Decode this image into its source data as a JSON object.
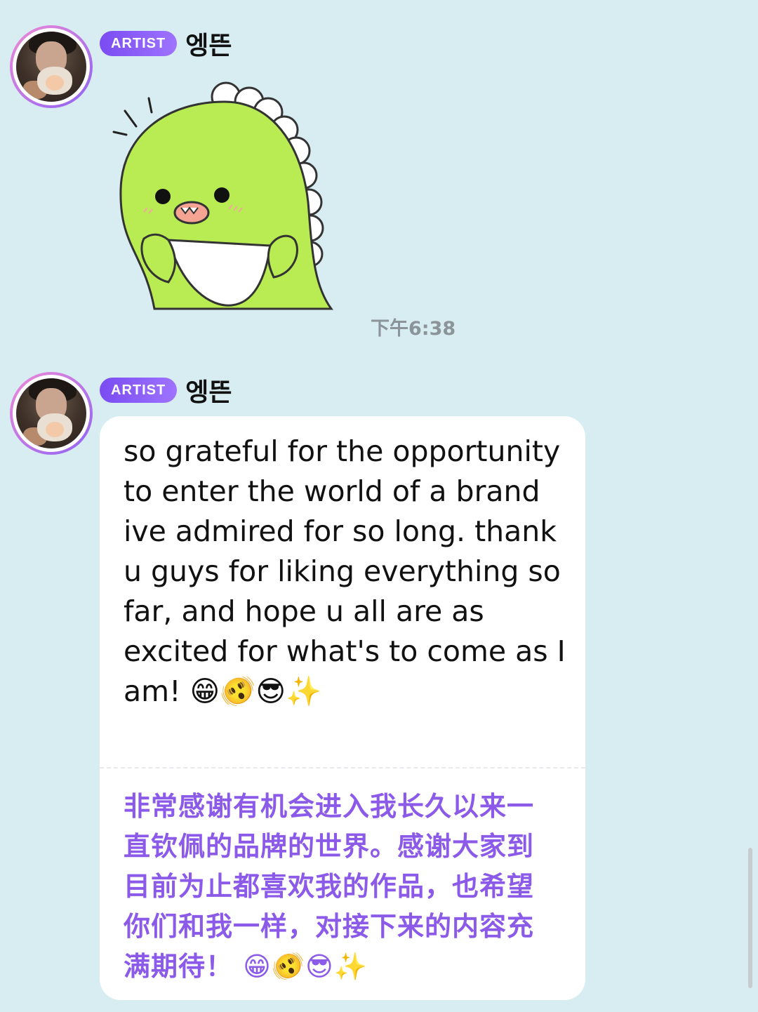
{
  "messages": [
    {
      "badge": "ARTIST",
      "author": "엥뜬",
      "type": "sticker",
      "sticker_icon": "green-dinosaur-sticker",
      "time": "下午6:38"
    },
    {
      "badge": "ARTIST",
      "author": "엥뜬",
      "type": "text",
      "text": "so grateful for the opportunity to enter the world of a brand ive admired for so long. thank u guys for liking everything so far, and hope u all are as excited for what's to come as I am! 😁🫨😎✨",
      "translation": "非常感谢有机会进入我长久以来一直钦佩的品牌的世界。感谢大家到目前为止都喜欢我的作品，也希望你们和我一样，对接下来的内容充满期待！ 😁🫨😎✨"
    }
  ],
  "colors": {
    "background": "#d7edf2",
    "badge": "#8a5ef5",
    "translation_text": "#8b5ae8",
    "timestamp": "#8a9499"
  }
}
